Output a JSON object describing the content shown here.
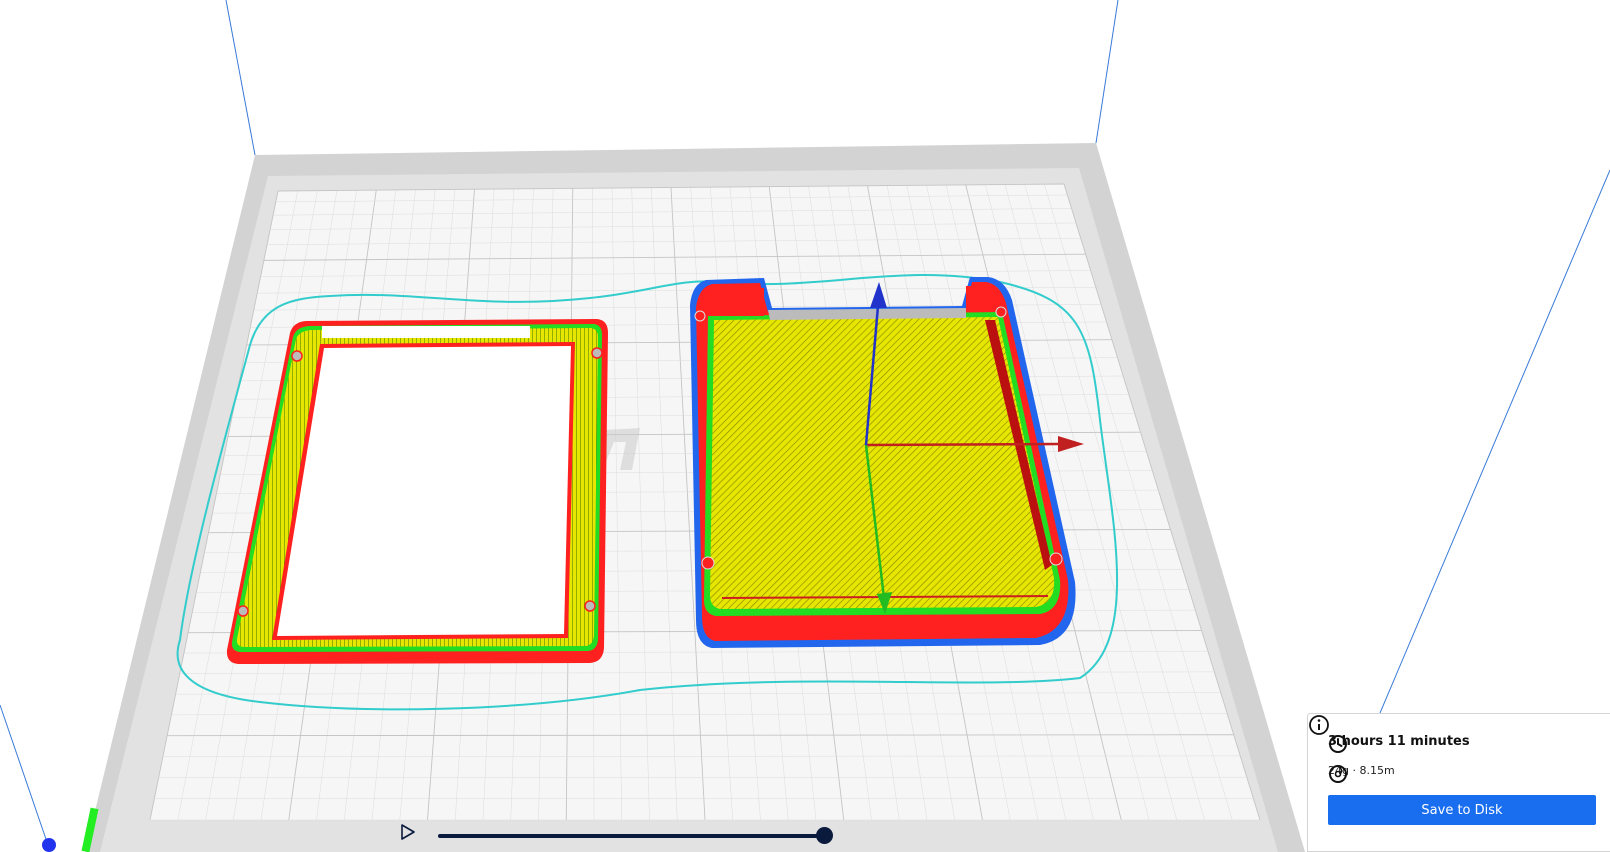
{
  "print_info": {
    "print_time": "3 hours 11 minutes",
    "material": "24g · 8.15m",
    "save_label": "Save to Disk"
  },
  "icons": {
    "time": "clock-icon",
    "material": "filament-spool-icon",
    "info": "info-icon",
    "play": "play-icon"
  },
  "colors": {
    "accent": "#196ef0",
    "wall_outer": "#ff2020",
    "wall_inner": "#22dd22",
    "infill": "#d8d800",
    "skirt": "#33cccc",
    "axis_x": "#c02020",
    "axis_y": "#22bb22",
    "axis_z": "#2233cc"
  },
  "simulation": {
    "progress": 1.0
  }
}
